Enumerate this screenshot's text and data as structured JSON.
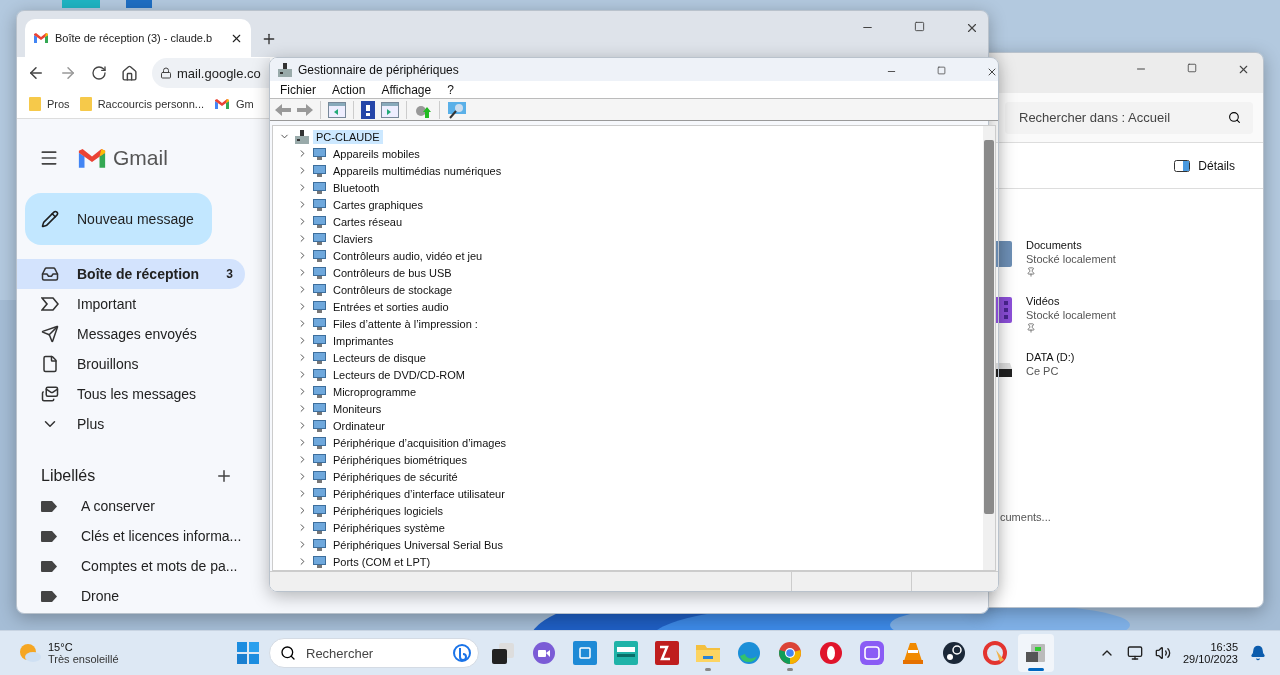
{
  "browser": {
    "tab_title": "Boîte de réception (3) - claude.b",
    "address": "mail.google.co",
    "bookmarks": [
      {
        "label": "Pros",
        "kind": "folder"
      },
      {
        "label": "Raccourcis personn...",
        "kind": "folder"
      },
      {
        "label": "Gm",
        "kind": "gmail"
      }
    ]
  },
  "gmail": {
    "logo": "Gmail",
    "compose": "Nouveau message",
    "nav": [
      {
        "label": "Boîte de réception",
        "kind": "inbox",
        "selected": true,
        "count": "3"
      },
      {
        "label": "Important",
        "kind": "important",
        "selected": false
      },
      {
        "label": "Messages envoyés",
        "kind": "sent",
        "selected": false
      },
      {
        "label": "Brouillons",
        "kind": "drafts",
        "selected": false
      },
      {
        "label": "Tous les messages",
        "kind": "all",
        "selected": false
      },
      {
        "label": "Plus",
        "kind": "more",
        "selected": false
      }
    ],
    "labels_title": "Libellés",
    "labels": [
      "A conserver",
      "Clés et licences informa...",
      "Comptes et mots de pa...",
      "Drone"
    ]
  },
  "device_manager": {
    "title": "Gestionnaire de périphériques",
    "menu": [
      "Fichier",
      "Action",
      "Affichage",
      "?"
    ],
    "root": {
      "label": "PC-CLAUDE",
      "selected": true,
      "expanded": true,
      "children": [
        {
          "label": "Appareils mobiles",
          "expanded": false
        },
        {
          "label": "Appareils multimédias numériques",
          "expanded": false
        },
        {
          "label": "Bluetooth",
          "expanded": false
        },
        {
          "label": "Cartes graphiques",
          "expanded": false
        },
        {
          "label": "Cartes réseau",
          "expanded": false
        },
        {
          "label": "Claviers",
          "expanded": false
        },
        {
          "label": "Contrôleurs audio, vidéo et jeu",
          "expanded": false
        },
        {
          "label": "Contrôleurs de bus USB",
          "expanded": false
        },
        {
          "label": "Contrôleurs de stockage",
          "expanded": false
        },
        {
          "label": "Entrées et sorties audio",
          "expanded": false
        },
        {
          "label": "Files d’attente à l’impression :",
          "expanded": false
        },
        {
          "label": "Imprimantes",
          "expanded": false
        },
        {
          "label": "Lecteurs de disque",
          "expanded": false
        },
        {
          "label": "Lecteurs de DVD/CD-ROM",
          "expanded": false
        },
        {
          "label": "Microprogramme",
          "expanded": false
        },
        {
          "label": "Moniteurs",
          "expanded": false
        },
        {
          "label": "Ordinateur",
          "expanded": false
        },
        {
          "label": "Périphérique d’acquisition d’images",
          "expanded": false
        },
        {
          "label": "Périphériques biométriques",
          "expanded": false
        },
        {
          "label": "Périphériques de sécurité",
          "expanded": false
        },
        {
          "label": "Périphériques d’interface utilisateur",
          "expanded": false
        },
        {
          "label": "Périphériques logiciels",
          "expanded": false
        },
        {
          "label": "Périphériques système",
          "expanded": false
        },
        {
          "label": "Périphériques Universal Serial Bus",
          "expanded": false
        },
        {
          "label": "Ports (COM et LPT)",
          "expanded": false
        }
      ]
    }
  },
  "explorer": {
    "search": {
      "placeholder": "Rechercher dans : Accueil"
    },
    "details": "Détails",
    "items": [
      {
        "name": "Documents",
        "location": "Stocké localement",
        "pinned": true,
        "kind": "documents"
      },
      {
        "name": "Vidéos",
        "location": "Stocké localement",
        "pinned": true,
        "kind": "videos"
      },
      {
        "name": "DATA (D:)",
        "location": "Ce PC",
        "pinned": false,
        "kind": "drive"
      }
    ],
    "footer_text": "cuments..."
  },
  "taskbar": {
    "weather": {
      "temperature": "15°C",
      "condition": "Très ensoleillé"
    },
    "search": {
      "placeholder": "Rechercher"
    },
    "apps": [
      {
        "kind": "taskview",
        "running": false,
        "active": false
      },
      {
        "kind": "meet",
        "running": false,
        "active": false
      },
      {
        "kind": "blueapp",
        "running": false,
        "active": false
      },
      {
        "kind": "sound",
        "running": false,
        "active": false
      },
      {
        "kind": "ftp",
        "running": false,
        "active": false
      },
      {
        "kind": "folder",
        "running": true,
        "active": false
      },
      {
        "kind": "edge",
        "running": false,
        "active": false
      },
      {
        "kind": "chrome",
        "running": true,
        "active": false
      },
      {
        "kind": "opera",
        "running": false,
        "active": false
      },
      {
        "kind": "purpleapp",
        "running": false,
        "active": false
      },
      {
        "kind": "vlc",
        "running": false,
        "active": false
      },
      {
        "kind": "steam",
        "running": false,
        "active": false
      },
      {
        "kind": "cleaner",
        "running": false,
        "active": false
      },
      {
        "kind": "devices",
        "running": true,
        "active": true
      }
    ],
    "time": "16:35",
    "date": "29/10/2023"
  }
}
